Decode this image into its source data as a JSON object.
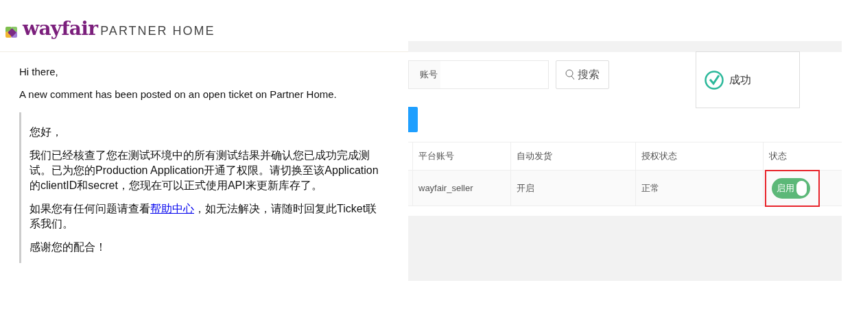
{
  "email": {
    "logo": {
      "brand": "wayfair",
      "product": "PARTNER HOME"
    },
    "greeting": "Hi there,",
    "intro": "A new comment has been posted on an open ticket on Partner Home.",
    "quote": {
      "greeting": "您好，",
      "body": "我们已经核查了您在测试环境中的所有测试结果并确认您已成功完成测试。已为您的Production Application开通了权限。请切换至该Application的clientID和secret，您现在可以正式使用API来更新库存了。",
      "help_before": "如果您有任何问题请查看",
      "help_link": "帮助中心",
      "help_after": "，如无法解决，请随时回复此Ticket联系我们。",
      "thanks": "感谢您的配合！"
    }
  },
  "app": {
    "search": {
      "label": "账号",
      "button": "搜索"
    },
    "toast": {
      "kind": "success",
      "text": "成功"
    },
    "table": {
      "columns": [
        "平台账号",
        "自动发货",
        "授权状态",
        "状态"
      ],
      "rows": [
        {
          "account": "wayfair_seller",
          "auto_ship": "开启",
          "auth_status": "正常",
          "status": {
            "label": "启用",
            "on": true,
            "highlighted": true
          }
        }
      ]
    }
  }
}
